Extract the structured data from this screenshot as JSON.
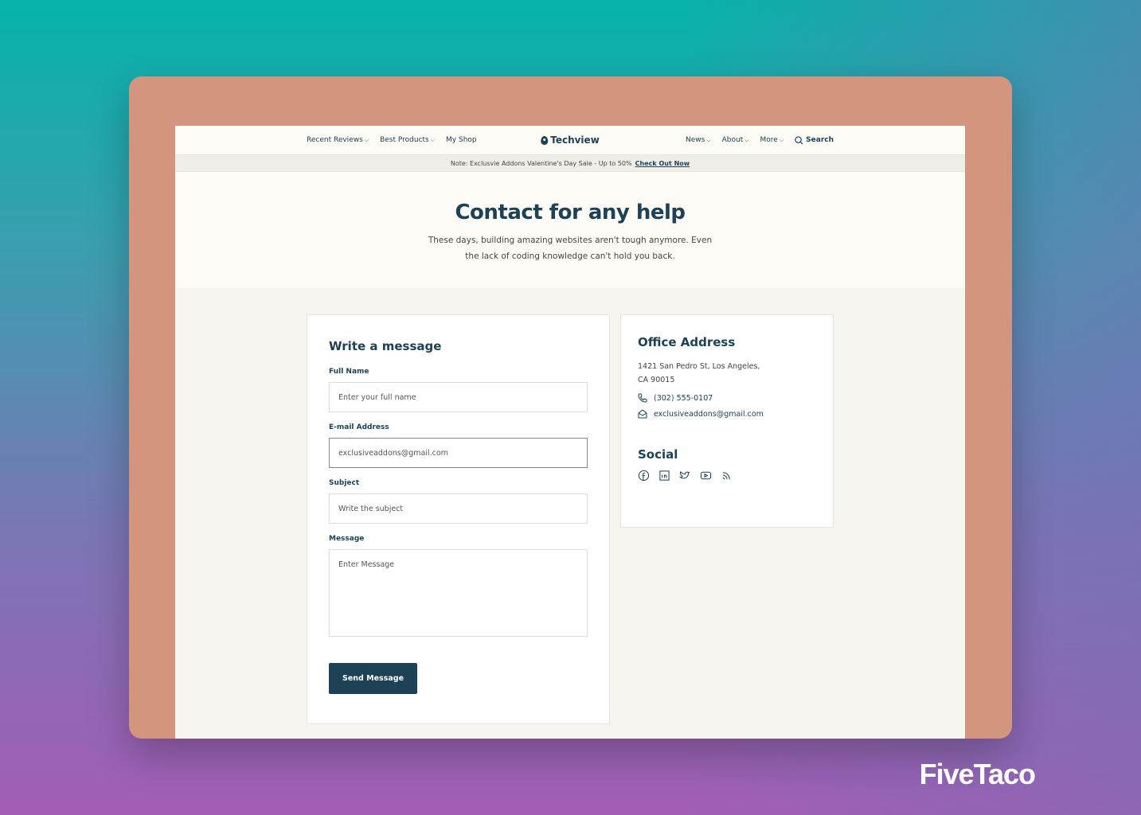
{
  "nav": {
    "left": [
      "Recent Reviews",
      "Best Products",
      "My Shop"
    ],
    "logo": "Techview",
    "right": [
      "News",
      "About",
      "More"
    ],
    "search": "Search"
  },
  "note": {
    "text": "Note: Exclusvie Addons Valentine's Day Sale - Up to 50%",
    "link": "Check Out Now"
  },
  "hero": {
    "title": "Contact for any help",
    "subtitle": "These days, building amazing websites aren't tough anymore. Even the lack of coding knowledge can't hold you back."
  },
  "form": {
    "title": "Write a message",
    "full_name_label": "Full Name",
    "full_name_placeholder": "Enter your full name",
    "email_label": "E-mail Address",
    "email_value": "exclusiveaddons@gmail.com",
    "subject_label": "Subject",
    "subject_placeholder": "Write the subject",
    "message_label": "Message",
    "message_placeholder": "Enter Message",
    "submit": "Send Message"
  },
  "office": {
    "title": "Office Address",
    "address_line1": "1421 San Pedro St, Los Angeles,",
    "address_line2": "CA 90015",
    "phone": "(302) 555-0107",
    "email": "exclusiveaddons@gmail.com",
    "social_title": "Social",
    "social_icons": [
      "facebook-icon",
      "linkedin-icon",
      "twitter-icon",
      "youtube-icon",
      "rss-icon"
    ]
  },
  "brand": "FiveTaco",
  "colors": {
    "primary": "#1d4155",
    "frame": "#d4957f"
  }
}
